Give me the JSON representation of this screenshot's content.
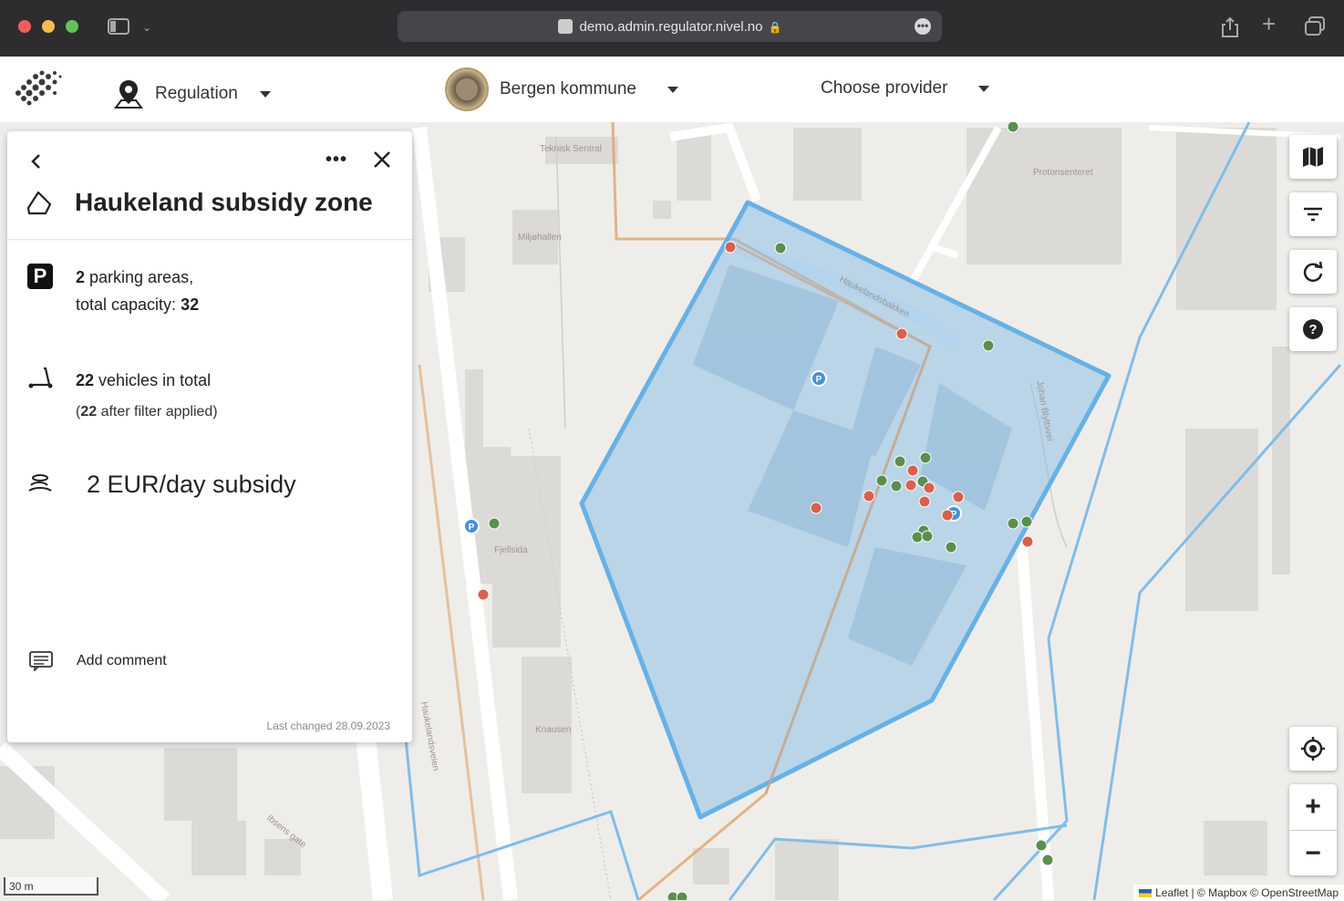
{
  "browser": {
    "url": "demo.admin.regulator.nivel.no"
  },
  "header": {
    "regulation_label": "Regulation",
    "municipality_label": "Bergen kommune",
    "provider_label": "Choose provider"
  },
  "panel": {
    "title": "Haukeland subsidy zone",
    "parking": {
      "count": "2",
      "count_suffix": " parking areas,",
      "capacity_prefix": "total capacity: ",
      "capacity": "32"
    },
    "vehicles": {
      "count": "22",
      "count_suffix": " vehicles in total",
      "filter_open": "(",
      "filter_count": "22",
      "filter_suffix": " after filter applied)"
    },
    "subsidy": "2 EUR/day subsidy",
    "add_comment": "Add comment",
    "last_changed": "Last changed 28.09.2023"
  },
  "map": {
    "street_labels": [
      "Teknisk Sentral",
      "Miljøhallen",
      "Haukelandsbakken",
      "Protonsenteret",
      "Fjellsida",
      "Knausen",
      "Haukelandsveien",
      "Ibsens gate",
      "Johan Blyttsvei"
    ],
    "scale_label": "30 m",
    "attribution": "Leaflet | © Mapbox © OpenStreetMap"
  },
  "colors": {
    "zone_fill": "#8ec0e6",
    "zone_stroke": "#67b1e6",
    "vehicle_available": "#5a8f4f",
    "vehicle_unavailable": "#d9604c",
    "parking_marker": "#4a8fd8"
  }
}
